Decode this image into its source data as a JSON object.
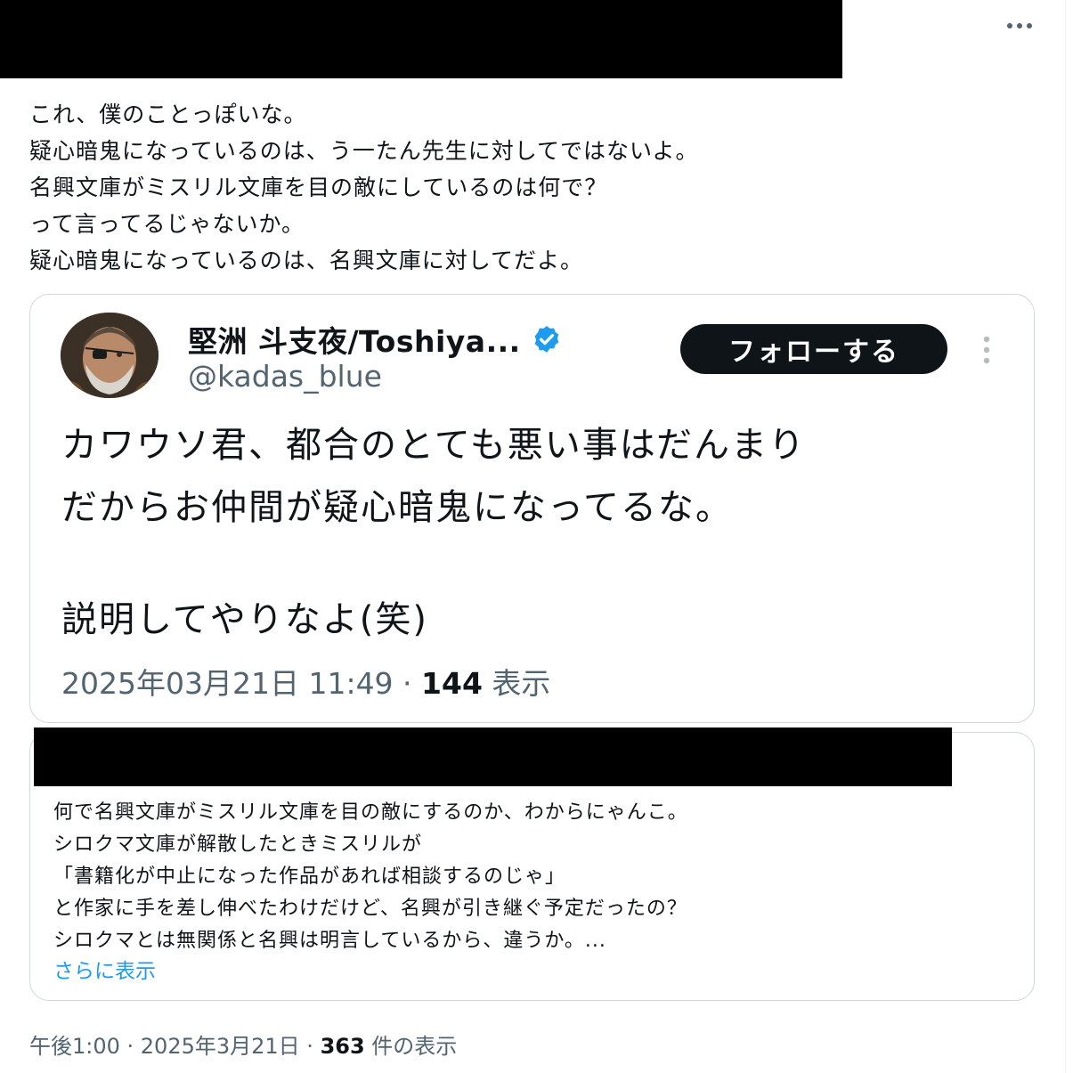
{
  "post": {
    "text": "これ、僕のことっぽいな。\n疑心暗鬼になっているのは、う一たん先生に対してではないよ。\n名興文庫がミスリル文庫を目の敵にしているのは何で？\nって言ってるじゃないか。\n疑心暗鬼になっているのは、名興文庫に対してだよ。",
    "meta_time": "午後1:00 · 2025年3月21日 · ",
    "views_count": "363",
    "views_label": " 件の表示"
  },
  "quote": {
    "display_name": "堅洲 斗支夜/Toshiya...",
    "handle": "@kadas_blue",
    "follow_label": "フォローする",
    "body_1": "カワウソ君、都合のとても悪い事はだんまり\nだからお仲間が疑心暗鬼になってるな。",
    "body_2": "説明してやりなよ(笑)",
    "meta_time": "2025年03月21日 11:49 · ",
    "views_count": "144",
    "views_label": " 表示"
  },
  "quoted_reply": {
    "text": "何で名興文庫がミスリル文庫を目の敵にするのか、わからにゃんこ。\nシロクマ文庫が解散したときミスリルが\n「書籍化が中止になった作品があれば相談するのじゃ」\nと作家に手を差し伸べたわけだけど、名興が引き継ぐ予定だったの？\nシロクマとは無関係と名興は明言しているから、違うか。...",
    "show_more": "さらに表示"
  },
  "icons": {
    "more": "more-horizontal-icon",
    "verified": "verified-badge-icon",
    "quote_more": "more-vertical-icon"
  },
  "colors": {
    "accent": "#1d9bf0",
    "text": "#0f1419",
    "muted": "#536471"
  }
}
